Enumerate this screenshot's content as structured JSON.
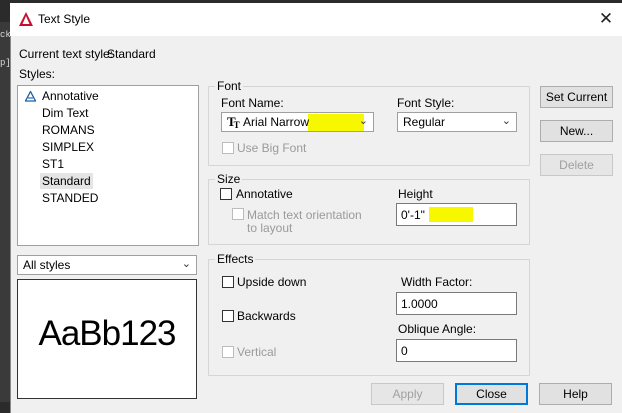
{
  "window": {
    "title": "Text Style",
    "close_glyph": "✕"
  },
  "left_strip": [
    "ck",
    "p]"
  ],
  "current_style": {
    "label": "Current text style:",
    "value": "Standard"
  },
  "styles_label": "Styles:",
  "styles": [
    {
      "label": "Annotative",
      "annotative": true
    },
    {
      "label": "Dim Text"
    },
    {
      "label": "ROMANS"
    },
    {
      "label": "SIMPLEX"
    },
    {
      "label": "ST1"
    },
    {
      "label": "Standard",
      "selected": true
    },
    {
      "label": "STANDED"
    }
  ],
  "filter": {
    "value": "All styles"
  },
  "preview": {
    "text": "AaBb123"
  },
  "font": {
    "group_title": "Font",
    "name_label": "Font Name:",
    "name_value": "Arial Narrow",
    "name_icon": "truetype-icon",
    "style_label": "Font Style:",
    "style_value": "Regular",
    "big_font_label": "Use Big Font",
    "big_font_checked": false
  },
  "size": {
    "group_title": "Size",
    "annotative_label": "Annotative",
    "annotative_checked": false,
    "match_label_1": "Match text orientation",
    "match_label_2": "to layout",
    "height_label": "Height",
    "height_value": "0'-1\""
  },
  "effects": {
    "group_title": "Effects",
    "upside_down_label": "Upside down",
    "backwards_label": "Backwards",
    "vertical_label": "Vertical",
    "width_label": "Width Factor:",
    "width_value": "1.0000",
    "oblique_label": "Oblique Angle:",
    "oblique_value": "0"
  },
  "buttons": {
    "set_current": "Set Current",
    "new": "New...",
    "delete": "Delete",
    "apply": "Apply",
    "close": "Close",
    "help": "Help"
  },
  "colors": {
    "highlight": "#f7f700",
    "accent": "#0078d7",
    "autocad_red": "#c8102e"
  }
}
